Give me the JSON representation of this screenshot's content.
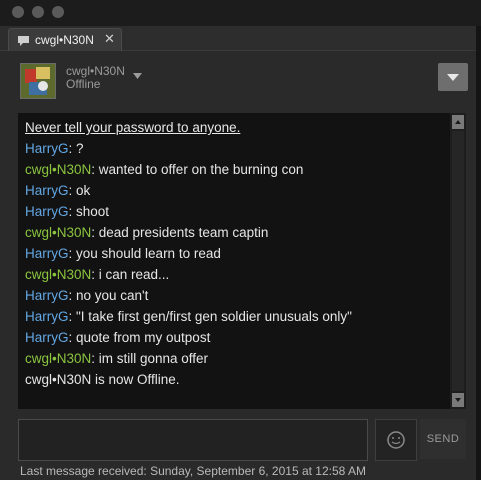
{
  "tab": {
    "title": "cwgl•N30N",
    "close": "✕"
  },
  "header": {
    "name": "cwgl•N30N",
    "status": "Offline"
  },
  "chat": {
    "warning": "Never tell your password to anyone.",
    "messages": [
      {
        "name": "HarryG",
        "text": ": ?"
      },
      {
        "name": "cwgl•N30N",
        "text": ": wanted to offer on the burning con"
      },
      {
        "name": "HarryG",
        "text": ": ok"
      },
      {
        "name": "HarryG",
        "text": ": shoot"
      },
      {
        "name": "cwgl•N30N",
        "text": ": dead presidents team captin"
      },
      {
        "name": "HarryG",
        "text": ": you should learn to read"
      },
      {
        "name": "cwgl•N30N",
        "text": ": i can read..."
      },
      {
        "name": "HarryG",
        "text": ": no you can't"
      },
      {
        "name": "HarryG",
        "text": ": \"I take first gen/first gen soldier unusuals only\""
      },
      {
        "name": "HarryG",
        "text": ": quote from my outpost"
      },
      {
        "name": "cwgl•N30N",
        "text": ": im still gonna offer"
      }
    ],
    "status_line": "cwgl•N30N is now Offline."
  },
  "composer": {
    "send_label": "SEND"
  },
  "footer": {
    "last_received": "Last message received: Sunday, September 6, 2015 at 12:58 AM"
  },
  "colors": {
    "harry": "#62a7e3",
    "cwgl": "#8bc53f",
    "chat_bg": "#121212",
    "window_bg": "#2a2a2a"
  },
  "icons": [
    "chat-bubble-icon",
    "close-icon",
    "chevron-down-icon",
    "emoji-icon",
    "scroll-up-icon",
    "scroll-down-icon"
  ]
}
